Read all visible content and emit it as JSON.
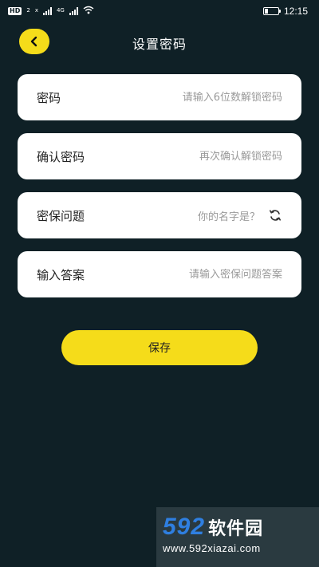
{
  "status_bar": {
    "hd_badge": "HD",
    "sim_slot": "2",
    "net_label_1": "x",
    "net_label_2": "4G",
    "time": "12:15",
    "icons": [
      "signal-icon",
      "wifi-icon",
      "battery-icon"
    ]
  },
  "header": {
    "title": "设置密码",
    "back_icon": "chevron-left-icon"
  },
  "form": {
    "password": {
      "label": "密码",
      "placeholder": "请输入6位数解锁密码"
    },
    "confirm_password": {
      "label": "确认密码",
      "placeholder": "再次确认解锁密码"
    },
    "security_question": {
      "label": "密保问题",
      "value": "你的名字是？",
      "icon": "refresh-icon"
    },
    "answer": {
      "label": "输入答案",
      "placeholder": "请输入密保问题答案"
    }
  },
  "actions": {
    "save_label": "保存"
  },
  "watermark": {
    "number": "592",
    "name": "软件园",
    "url": "www.592xiazai.com"
  },
  "colors": {
    "background": "#0f2026",
    "accent": "#f5dc1a",
    "card": "#ffffff",
    "placeholder": "#9a9a9a"
  }
}
